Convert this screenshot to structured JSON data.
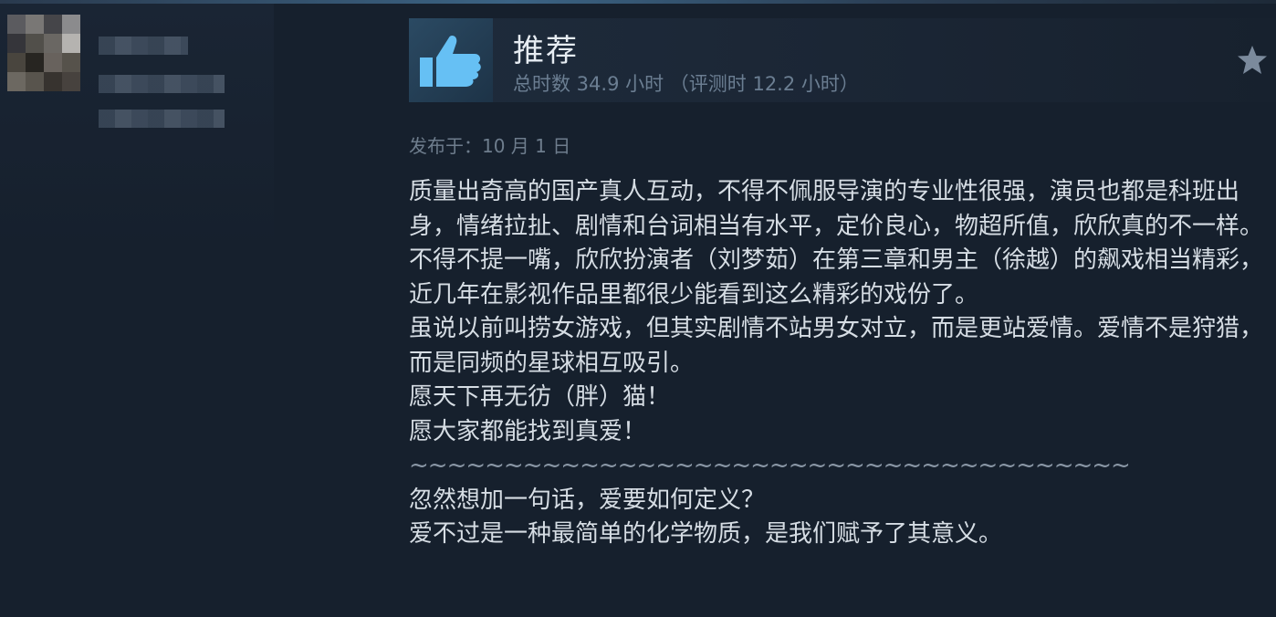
{
  "user": {
    "avatar_icon": "blurred-avatar"
  },
  "review": {
    "verdict": "推荐",
    "verdict_icon": "thumbs-up-icon",
    "hours_text": "总时数 34.9 小时 （评测时 12.2 小时）",
    "posted": "发布于：10 月 1 日",
    "paragraphs": [
      "质量出奇高的国产真人互动，不得不佩服导演的专业性很强，演员也都是科班出身，情绪拉扯、剧情和台词相当有水平，定价良心，物超所值，欣欣真的不一样。不得不提一嘴，欣欣扮演者（刘梦茹）在第三章和男主（徐越）的飙戏相当精彩，近几年在影视作品里都很少能看到这么精彩的戏份了。",
      "虽说以前叫捞女游戏，但其实剧情不站男女对立，而是更站爱情。爱情不是狩猎，而是同频的星球相互吸引。",
      "愿天下再无彷（胖）猫！",
      "愿大家都能找到真爱！",
      "~~~~~~~~~~~~~~~~~~~~~~~~~~~~~~~~~~~~~~",
      "忽然想加一句话，爱要如何定义？",
      "爱不过是一种最简单的化学物质，是我们赋予了其意义。"
    ]
  },
  "colors": {
    "background": "#16202d",
    "header_bg": "#1e2b3b",
    "thumb_blue": "#66c0f4",
    "text": "#d6dde4",
    "muted": "#6b7e92"
  }
}
